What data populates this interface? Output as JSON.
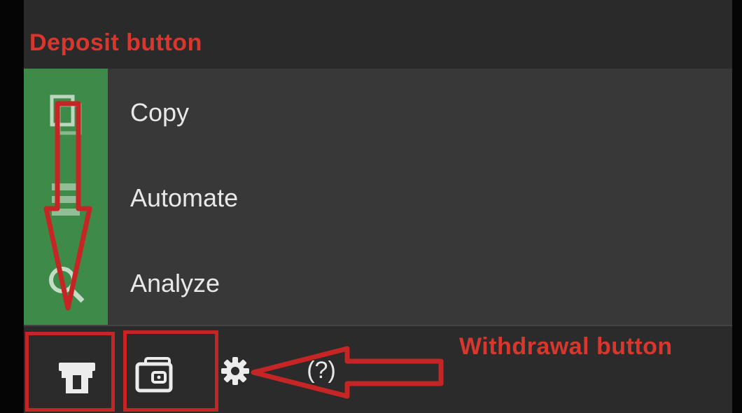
{
  "annotations": {
    "deposit_label": "Deposit button",
    "withdrawal_label": "Withdrawal button",
    "color": "#c62525"
  },
  "menu": {
    "accent_color": "#3e8b49",
    "items": [
      {
        "label": "Copy",
        "icon": "copy-icon"
      },
      {
        "label": "Automate",
        "icon": "automate-icon"
      },
      {
        "label": "Analyze",
        "icon": "search-icon"
      }
    ]
  },
  "toolbar": {
    "buttons": [
      {
        "name": "deposit",
        "icon": "deposit-icon"
      },
      {
        "name": "withdrawal",
        "icon": "wallet-icon"
      },
      {
        "name": "settings",
        "icon": "gear-icon"
      },
      {
        "name": "help",
        "icon": "help-icon",
        "glyph": "(?)"
      }
    ]
  }
}
